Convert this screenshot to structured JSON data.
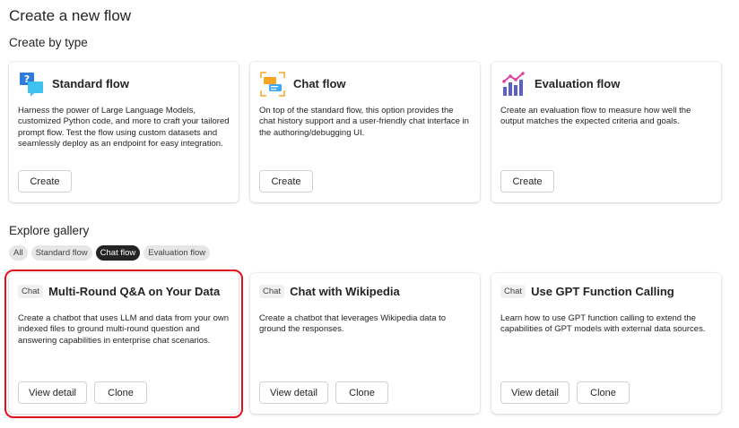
{
  "page": {
    "title": "Create a new flow"
  },
  "create_by_type": {
    "heading": "Create by type",
    "cards": [
      {
        "title": "Standard flow",
        "icon": "standard-flow-icon",
        "description": "Harness the power of Large Language Models, customized Python code, and more to craft your tailored prompt flow. Test the flow using custom datasets and seamlessly deploy as an endpoint for easy integration.",
        "button": "Create"
      },
      {
        "title": "Chat flow",
        "icon": "chat-flow-icon",
        "description": "On top of the standard flow, this option provides the chat history support and a user-friendly chat interface in the authoring/debugging UI.",
        "button": "Create"
      },
      {
        "title": "Evaluation flow",
        "icon": "evaluation-flow-icon",
        "description": "Create an evaluation flow to measure how well the output matches the expected criteria and goals.",
        "button": "Create"
      }
    ]
  },
  "gallery": {
    "heading": "Explore gallery",
    "filters": [
      {
        "label": "All",
        "active": false
      },
      {
        "label": "Standard flow",
        "active": false
      },
      {
        "label": "Chat flow",
        "active": true
      },
      {
        "label": "Evaluation flow",
        "active": false
      }
    ],
    "cards": [
      {
        "tag": "Chat",
        "title": "Multi-Round Q&A on Your Data",
        "description": "Create a chatbot that uses LLM and data from your own indexed files to ground multi-round question and answering capabilities in enterprise chat scenarios.",
        "view_label": "View detail",
        "clone_label": "Clone",
        "highlighted": true
      },
      {
        "tag": "Chat",
        "title": "Chat with Wikipedia",
        "description": "Create a chatbot that leverages Wikipedia data to ground the responses.",
        "view_label": "View detail",
        "clone_label": "Clone",
        "highlighted": false
      },
      {
        "tag": "Chat",
        "title": "Use GPT Function Calling",
        "description": "Learn how to use GPT function calling to extend the capabilities of GPT models with external data sources.",
        "view_label": "View detail",
        "clone_label": "Clone",
        "highlighted": false
      }
    ]
  },
  "colors": {
    "highlight": "#e0101c",
    "pill_active": "#242424",
    "pill": "#e6e6e6"
  }
}
